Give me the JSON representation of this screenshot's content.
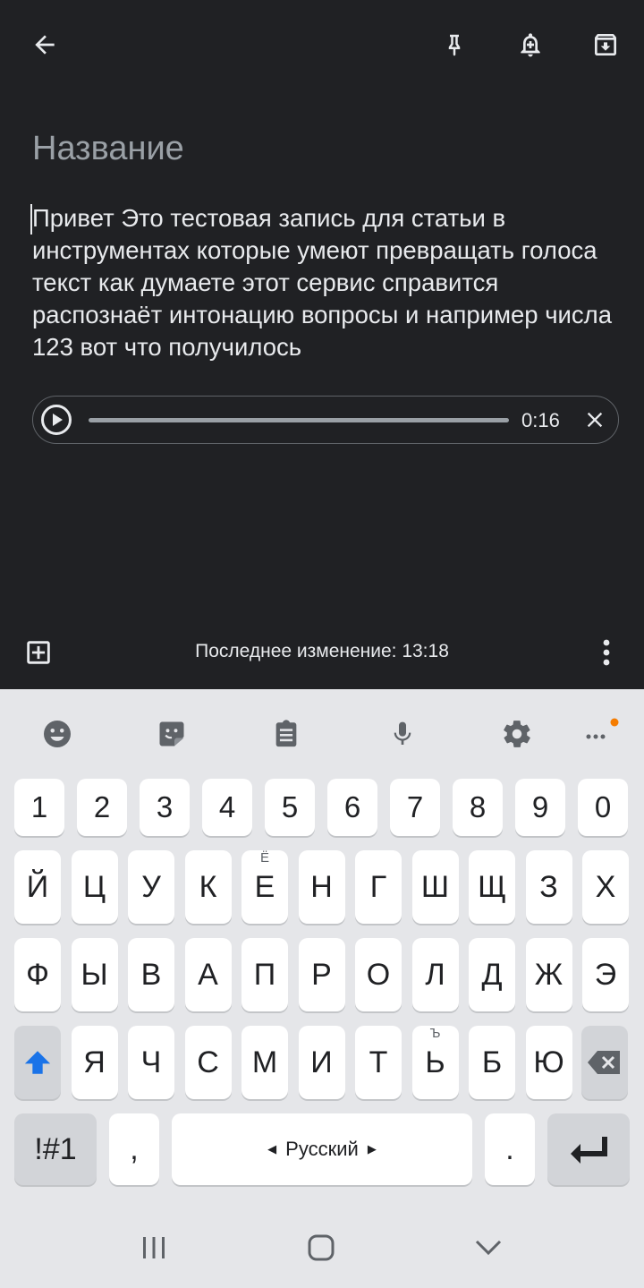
{
  "note": {
    "title_placeholder": "Название",
    "body": "Привет Это тестовая запись для статьи в инструментах которые умеют превращать голоса текст как думаете этот сервис справится распознаёт интонацию вопросы и например числа 123 вот что получилось",
    "audio": {
      "duration": "0:16",
      "progress": 0.0
    }
  },
  "toolbar_icons": [
    "back-arrow-icon",
    "pin-icon",
    "reminder-bell-icon",
    "archive-icon"
  ],
  "footer": {
    "last_edited": "Последнее изменение: 13:18"
  },
  "keyboard": {
    "toolbar": [
      "emoji-icon",
      "sticker-icon",
      "clipboard-icon",
      "microphone-icon",
      "settings-gear-icon",
      "more-icon"
    ],
    "row_numbers": [
      "1",
      "2",
      "3",
      "4",
      "5",
      "6",
      "7",
      "8",
      "9",
      "0"
    ],
    "row1": [
      "Й",
      "Ц",
      "У",
      "К",
      "Е",
      "Н",
      "Г",
      "Ш",
      "Щ",
      "З",
      "Х"
    ],
    "row1_sup": {
      "Е": "Ё"
    },
    "row2": [
      "Ф",
      "Ы",
      "В",
      "А",
      "П",
      "Р",
      "О",
      "Л",
      "Д",
      "Ж",
      "Э"
    ],
    "row3": [
      "Я",
      "Ч",
      "С",
      "М",
      "И",
      "Т",
      "Ь",
      "Б",
      "Ю"
    ],
    "row3_sup": {
      "Ь": "Ъ"
    },
    "symbols_label": "!#1",
    "comma": ",",
    "space_label": "Русский",
    "period": "."
  },
  "colors": {
    "note_bg": "#202124",
    "keyboard_bg": "#e5e6e9",
    "shift_accent": "#1a73e8",
    "notification_dot": "#f57c00"
  }
}
